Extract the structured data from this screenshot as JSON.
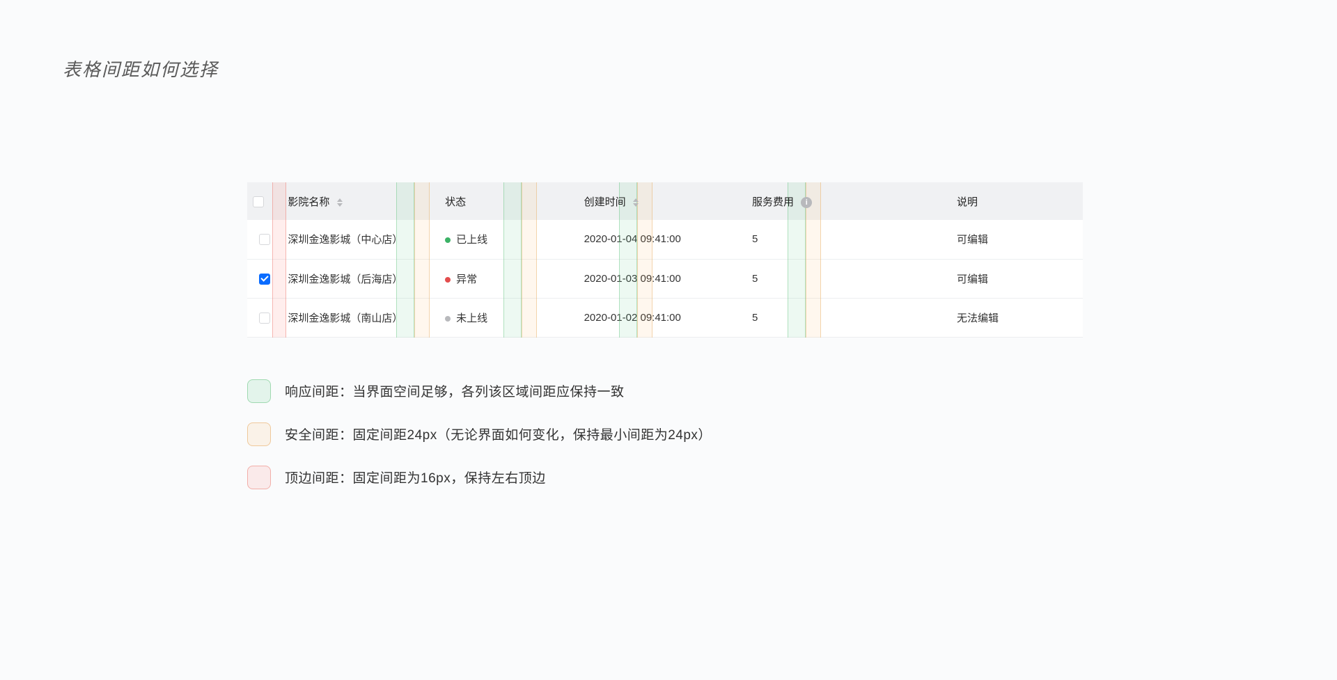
{
  "title": "表格间距如何选择",
  "headers": {
    "name": "影院名称",
    "status": "状态",
    "time": "创建时间",
    "fee": "服务费用",
    "desc": "说明"
  },
  "rows": [
    {
      "checked": false,
      "name": "深圳金逸影城（中心店）",
      "status": "已上线",
      "dot": "green",
      "time": "2020-01-04  09:41:00",
      "fee": "5",
      "desc": "可编辑"
    },
    {
      "checked": true,
      "name": "深圳金逸影城（后海店）",
      "status": "异常",
      "dot": "red",
      "time": "2020-01-03  09:41:00",
      "fee": "5",
      "desc": "可编辑"
    },
    {
      "checked": false,
      "name": "深圳金逸影城（南山店）",
      "status": "未上线",
      "dot": "gray",
      "time": "2020-01-02  09:41:00",
      "fee": "5",
      "desc": "无法编辑"
    }
  ],
  "legend": {
    "green": "响应间距：当界面空间足够，各列该区域间距应保持一致",
    "orange": "安全间距：固定间距24px（无论界面如何变化，保持最小间距为24px）",
    "red": "顶边间距：固定间距为16px，保持左右顶边"
  }
}
